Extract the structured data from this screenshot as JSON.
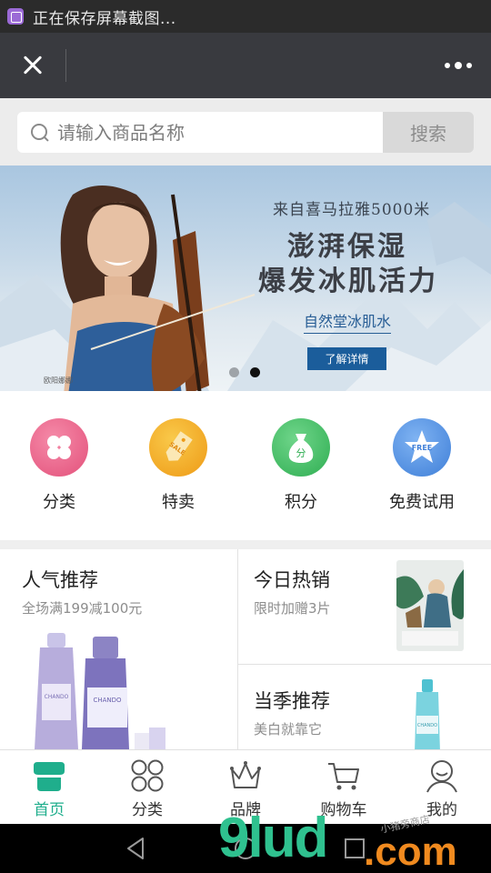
{
  "status_bar": {
    "text": "正在保存屏幕截图..."
  },
  "search": {
    "placeholder": "请输入商品名称",
    "button_label": "搜索"
  },
  "banner": {
    "subtitle": "来自喜马拉雅5000米",
    "headline_1": "澎湃保湿",
    "headline_2": "爆发冰肌活力",
    "brand": "自然堂冰肌水",
    "cta": "了解详情",
    "caption": "欧阳娜娜",
    "slide_count": 2,
    "active_slide": 2
  },
  "quick_entries": [
    {
      "label": "分类",
      "icon": "grid-four-icon",
      "color": "#ee5f86"
    },
    {
      "label": "特卖",
      "icon": "sale-tag-icon",
      "color": "#f3a823"
    },
    {
      "label": "积分",
      "icon": "money-bag-icon",
      "color": "#3dbb5e"
    },
    {
      "label": "免费试用",
      "icon": "free-star-icon",
      "color": "#4f8fe0"
    }
  ],
  "products": {
    "popular": {
      "title": "人气推荐",
      "subtitle": "全场满199减100元"
    },
    "hot_today": {
      "title": "今日热销",
      "subtitle": "限时加赠3片"
    },
    "season": {
      "title": "当季推荐",
      "subtitle": "美白就靠它"
    },
    "brand_on_pack": "CHANDO"
  },
  "tabbar": {
    "active_color": "#1fae8c",
    "items": [
      {
        "label": "首页",
        "icon": "home-store-icon"
      },
      {
        "label": "分类",
        "icon": "category-grid-icon"
      },
      {
        "label": "品牌",
        "icon": "crown-icon"
      },
      {
        "label": "购物车",
        "icon": "cart-icon"
      },
      {
        "label": "我的",
        "icon": "user-icon"
      }
    ]
  },
  "watermark": {
    "main": "9lud",
    "suffix": ".com",
    "small": "小猪旁商店"
  }
}
